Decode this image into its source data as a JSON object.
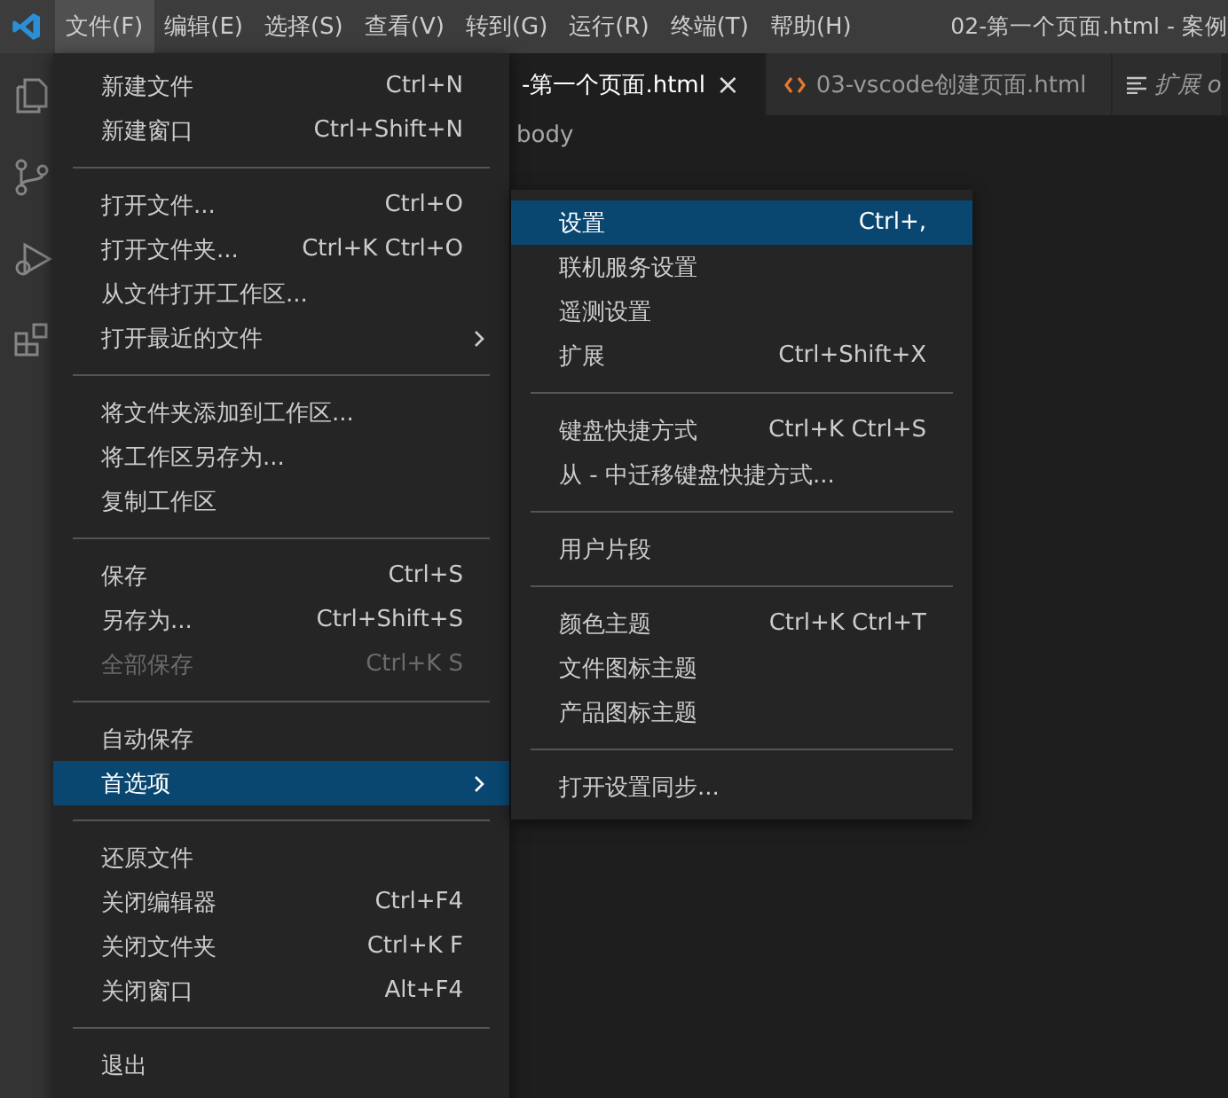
{
  "window": {
    "title": "02-第一个页面.html - 案例"
  },
  "menubar": [
    {
      "label": "文件(F)",
      "selected": true
    },
    {
      "label": "编辑(E)",
      "selected": false
    },
    {
      "label": "选择(S)",
      "selected": false
    },
    {
      "label": "查看(V)",
      "selected": false
    },
    {
      "label": "转到(G)",
      "selected": false
    },
    {
      "label": "运行(R)",
      "selected": false
    },
    {
      "label": "终端(T)",
      "selected": false
    },
    {
      "label": "帮助(H)",
      "selected": false
    }
  ],
  "tabs": [
    {
      "kind": "file",
      "label": "-第一个页面.html",
      "selected": true,
      "close": "×"
    },
    {
      "kind": "html",
      "label": "03-vscode创建页面.html",
      "selected": false
    },
    {
      "kind": "preview",
      "label": "扩展 o",
      "selected": false
    }
  ],
  "breadcrumb": "body",
  "file_menu": [
    {
      "kind": "item",
      "label": "新建文件",
      "shortcut": "Ctrl+N",
      "disabled": false,
      "selected": false
    },
    {
      "kind": "item",
      "label": "新建窗口",
      "shortcut": "Ctrl+Shift+N",
      "disabled": false,
      "selected": false
    },
    {
      "kind": "separator"
    },
    {
      "kind": "item",
      "label": "打开文件...",
      "shortcut": "Ctrl+O",
      "disabled": false,
      "selected": false
    },
    {
      "kind": "item",
      "label": "打开文件夹...",
      "shortcut": "Ctrl+K Ctrl+O",
      "disabled": false,
      "selected": false
    },
    {
      "kind": "item",
      "label": "从文件打开工作区...",
      "disabled": false,
      "selected": false
    },
    {
      "kind": "submenu",
      "label": "打开最近的文件",
      "disabled": false,
      "selected": false
    },
    {
      "kind": "separator"
    },
    {
      "kind": "item",
      "label": "将文件夹添加到工作区...",
      "disabled": false,
      "selected": false
    },
    {
      "kind": "item",
      "label": "将工作区另存为...",
      "disabled": false,
      "selected": false
    },
    {
      "kind": "item",
      "label": "复制工作区",
      "disabled": false,
      "selected": false
    },
    {
      "kind": "separator"
    },
    {
      "kind": "item",
      "label": "保存",
      "shortcut": "Ctrl+S",
      "disabled": false,
      "selected": false
    },
    {
      "kind": "item",
      "label": "另存为...",
      "shortcut": "Ctrl+Shift+S",
      "disabled": false,
      "selected": false
    },
    {
      "kind": "item",
      "label": "全部保存",
      "shortcut": "Ctrl+K S",
      "disabled": true,
      "selected": false
    },
    {
      "kind": "separator"
    },
    {
      "kind": "item",
      "label": "自动保存",
      "disabled": false,
      "selected": false
    },
    {
      "kind": "submenu",
      "label": "首选项",
      "disabled": false,
      "selected": true
    },
    {
      "kind": "separator"
    },
    {
      "kind": "item",
      "label": "还原文件",
      "disabled": false,
      "selected": false
    },
    {
      "kind": "item",
      "label": "关闭编辑器",
      "shortcut": "Ctrl+F4",
      "disabled": false,
      "selected": false
    },
    {
      "kind": "item",
      "label": "关闭文件夹",
      "shortcut": "Ctrl+K F",
      "disabled": false,
      "selected": false
    },
    {
      "kind": "item",
      "label": "关闭窗口",
      "shortcut": "Alt+F4",
      "disabled": false,
      "selected": false
    },
    {
      "kind": "separator"
    },
    {
      "kind": "item",
      "label": "退出",
      "disabled": false,
      "selected": false
    }
  ],
  "preferences_menu": [
    {
      "kind": "item",
      "label": "设置",
      "shortcut": "Ctrl+,",
      "selected": true
    },
    {
      "kind": "item",
      "label": "联机服务设置",
      "selected": false
    },
    {
      "kind": "item",
      "label": "遥测设置",
      "selected": false
    },
    {
      "kind": "item",
      "label": "扩展",
      "shortcut": "Ctrl+Shift+X",
      "selected": false
    },
    {
      "kind": "separator"
    },
    {
      "kind": "item",
      "label": "键盘快捷方式",
      "shortcut": "Ctrl+K Ctrl+S",
      "selected": false
    },
    {
      "kind": "item",
      "label": "从 - 中迁移键盘快捷方式...",
      "selected": false
    },
    {
      "kind": "separator"
    },
    {
      "kind": "item",
      "label": "用户片段",
      "selected": false
    },
    {
      "kind": "separator"
    },
    {
      "kind": "item",
      "label": "颜色主题",
      "shortcut": "Ctrl+K Ctrl+T",
      "selected": false
    },
    {
      "kind": "item",
      "label": "文件图标主题",
      "selected": false
    },
    {
      "kind": "item",
      "label": "产品图标主题",
      "selected": false
    },
    {
      "kind": "separator"
    },
    {
      "kind": "item",
      "label": "打开设置同步...",
      "selected": false
    }
  ]
}
